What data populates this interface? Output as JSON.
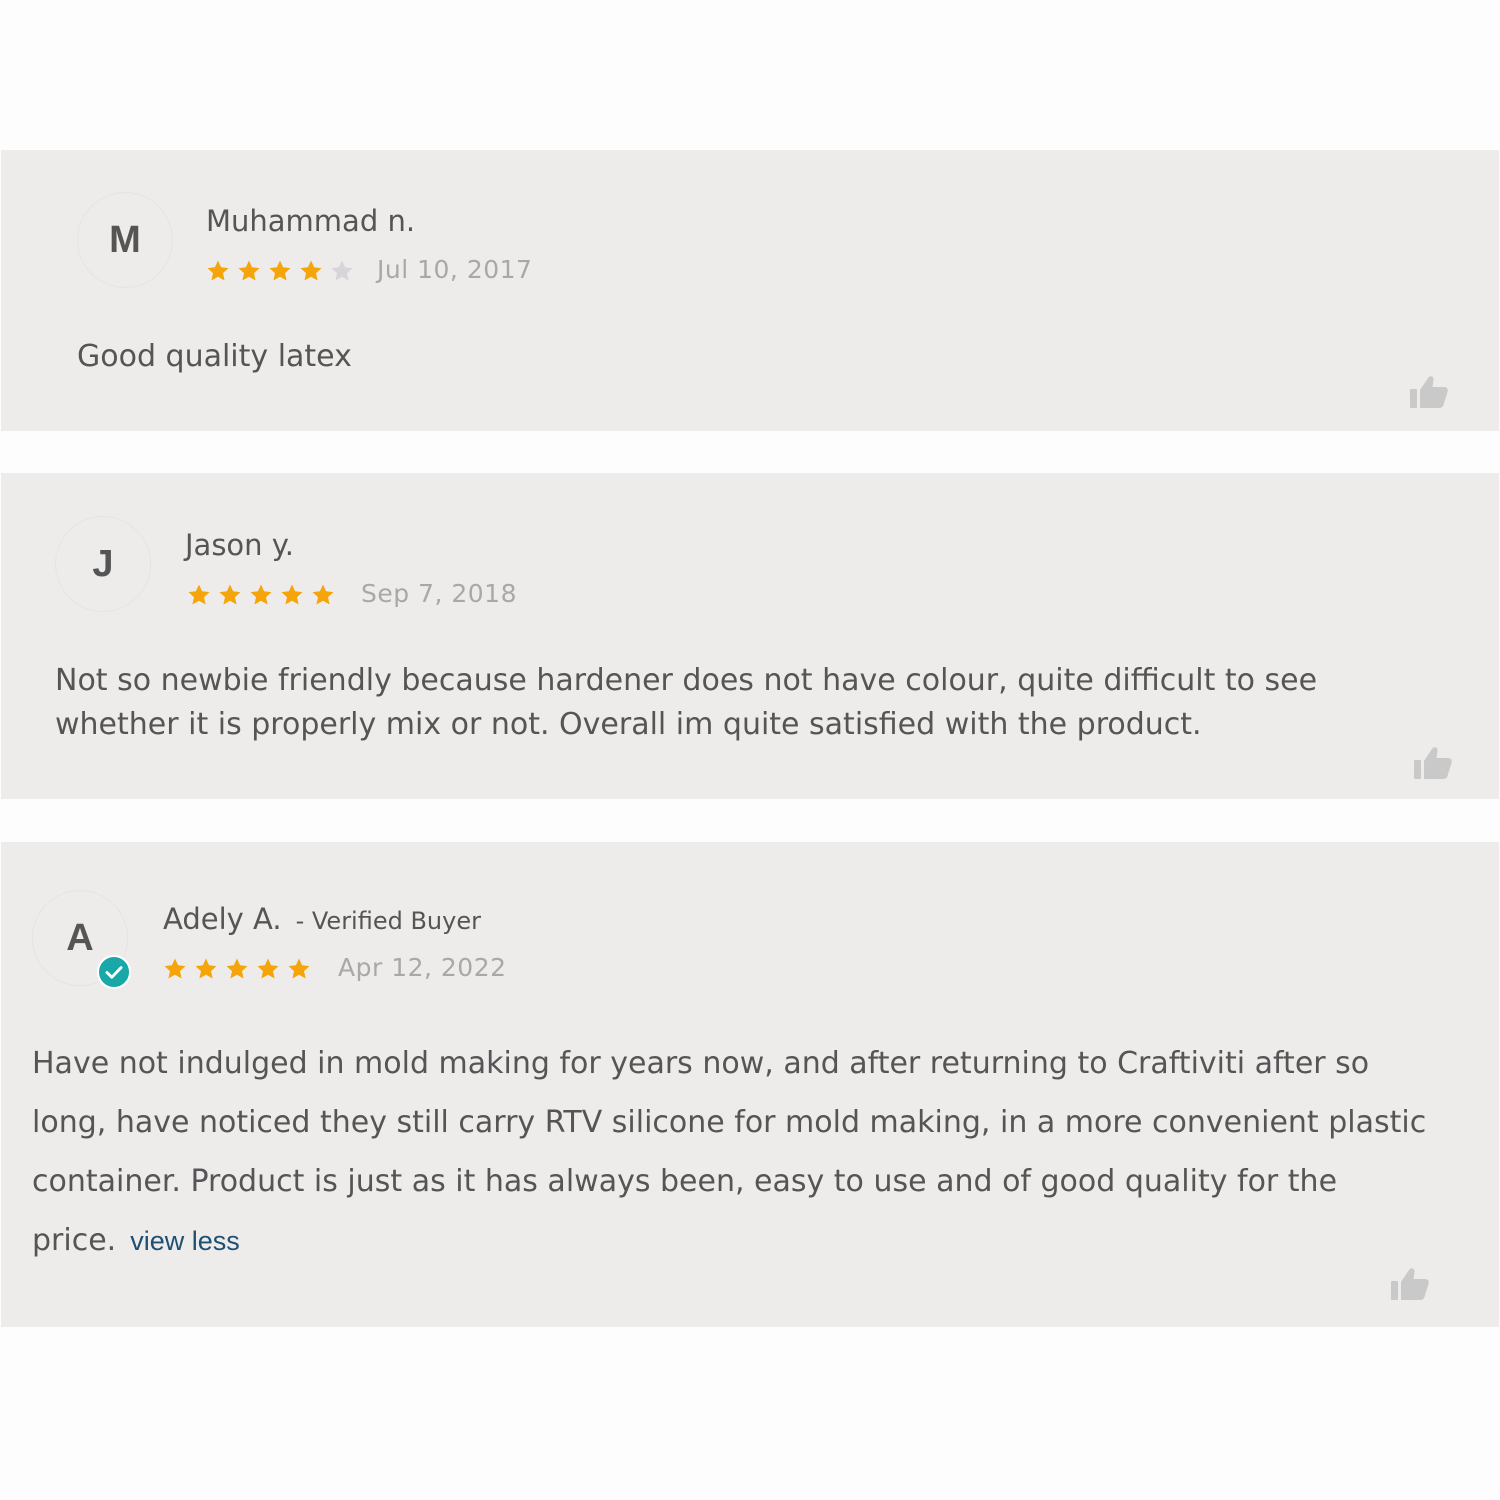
{
  "reviews": [
    {
      "initial": "M",
      "name": "Muhammad n.",
      "rating": 4,
      "date": "Jul 10, 2017",
      "text": "Good quality latex"
    },
    {
      "initial": "J",
      "name": "Jason y.",
      "rating": 5,
      "date": "Sep 7, 2018",
      "text": "Not so newbie friendly because hardener does not have colour, quite difficult to see whether it is properly mix or not. Overall im quite satisfied with the product."
    },
    {
      "initial": "A",
      "name": "Adely A.",
      "badge": "- Verified Buyer",
      "rating": 5,
      "date": "Apr 12, 2022",
      "text": "Have not indulged in mold making for years now, and after returning to Craftiviti after so long, have noticed they still carry RTV silicone for mold making, in a more convenient plastic container. Product is just as it has always been, easy to use and of good quality for the price.",
      "toggle_label": "view less"
    }
  ],
  "colors": {
    "star_filled": "#f5a50a",
    "star_empty": "#d6d6d8",
    "verified": "#19a8a8",
    "link": "#1f4f72",
    "card_bg": "#eeeceb"
  },
  "icons": {
    "star": "star-icon",
    "thumb": "thumbs-up-icon",
    "verified": "check-circle-icon"
  }
}
